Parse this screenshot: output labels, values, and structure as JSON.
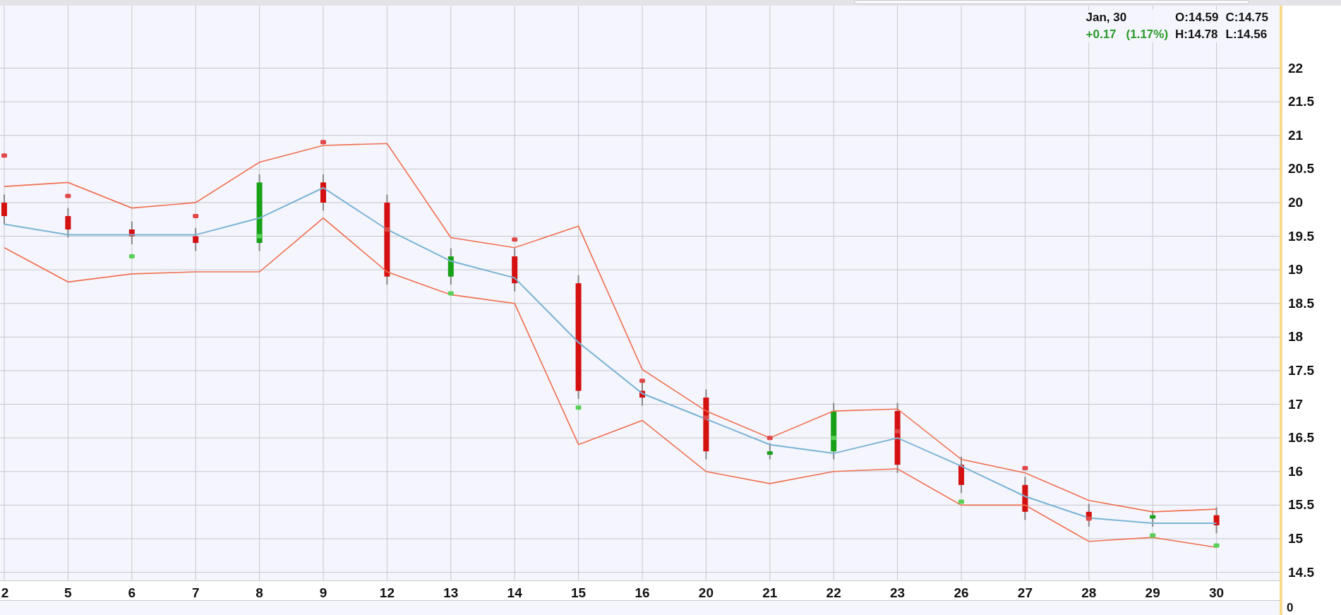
{
  "quote": {
    "date": "Jan, 30",
    "open": "O:14.59",
    "close": "C:14.75",
    "change": "+0.17",
    "change_pct": "(1.17%)",
    "high": "H:14.78",
    "low": "L:14.56"
  },
  "chart_data": {
    "type": "candlestick",
    "grid": true,
    "categories": [
      "2",
      "5",
      "6",
      "7",
      "8",
      "9",
      "12",
      "13",
      "14",
      "15",
      "16",
      "20",
      "21",
      "22",
      "23",
      "26",
      "27",
      "28",
      "29",
      "30"
    ],
    "ylim": [
      14.38,
      22.93
    ],
    "yticks": [
      14.5,
      15,
      15.5,
      16,
      16.5,
      17,
      17.5,
      18,
      18.5,
      19,
      19.5,
      20,
      20.5,
      21,
      21.5,
      22
    ],
    "ohlc": [
      [
        20.0,
        20.12,
        19.68,
        19.8
      ],
      [
        19.8,
        19.92,
        19.48,
        19.6
      ],
      [
        19.6,
        19.72,
        19.38,
        19.5
      ],
      [
        19.5,
        19.62,
        19.28,
        19.4
      ],
      [
        19.4,
        20.42,
        19.28,
        20.3
      ],
      [
        20.3,
        20.42,
        19.88,
        20.0
      ],
      [
        20.0,
        20.12,
        18.78,
        18.9
      ],
      [
        18.9,
        19.32,
        18.78,
        19.2
      ],
      [
        19.2,
        19.32,
        18.68,
        18.8
      ],
      [
        18.8,
        18.92,
        17.08,
        17.2
      ],
      [
        17.2,
        17.32,
        16.98,
        17.1
      ],
      [
        17.1,
        17.22,
        16.18,
        16.3
      ],
      [
        16.25,
        16.42,
        16.18,
        16.3
      ],
      [
        16.3,
        17.02,
        16.18,
        16.9
      ],
      [
        16.9,
        17.02,
        15.98,
        16.1
      ],
      [
        16.1,
        16.22,
        15.68,
        15.8
      ],
      [
        15.8,
        15.92,
        15.28,
        15.4
      ],
      [
        15.4,
        15.52,
        15.18,
        15.3
      ],
      [
        15.3,
        15.42,
        15.18,
        15.35
      ],
      [
        15.35,
        15.47,
        15.08,
        15.2
      ]
    ],
    "series": [
      {
        "type": "line",
        "color": "#f07050",
        "values": [
          20.24,
          20.3,
          19.92,
          20.0,
          20.6,
          20.85,
          20.88,
          19.48,
          19.33,
          19.65,
          17.52,
          16.9,
          16.5,
          16.9,
          16.93,
          16.18,
          15.98,
          15.57,
          15.4,
          15.44
        ]
      },
      {
        "type": "line",
        "color": "#f07050",
        "values": [
          19.33,
          18.82,
          18.94,
          18.97,
          18.97,
          19.77,
          18.97,
          18.63,
          18.5,
          16.4,
          16.76,
          16.0,
          15.82,
          16.0,
          16.04,
          15.5,
          15.5,
          14.96,
          15.02,
          14.87
        ]
      },
      {
        "type": "line",
        "color": "#7ab4d4",
        "values": [
          19.68,
          19.52,
          19.52,
          19.52,
          19.77,
          20.22,
          19.6,
          19.13,
          18.88,
          17.92,
          17.16,
          16.78,
          16.4,
          16.27,
          16.5,
          16.08,
          15.63,
          15.31,
          15.23,
          15.23
        ]
      },
      {
        "type": "scatter",
        "color": "#e04848",
        "values": [
          20.7,
          20.1,
          null,
          19.8,
          null,
          20.9,
          19.6,
          null,
          19.45,
          null,
          17.35,
          16.8,
          16.5,
          null,
          16.6,
          null,
          16.05,
          15.3,
          null,
          null
        ]
      },
      {
        "type": "scatter",
        "color": "#58d058",
        "values": [
          null,
          null,
          19.2,
          null,
          19.5,
          null,
          null,
          18.65,
          null,
          16.95,
          null,
          null,
          null,
          16.5,
          null,
          15.55,
          null,
          null,
          15.05,
          14.9
        ]
      }
    ]
  },
  "lower_panel": {
    "axis_label": "0"
  }
}
